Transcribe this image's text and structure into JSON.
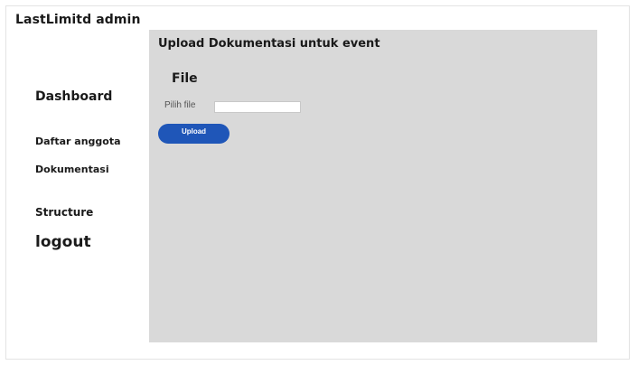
{
  "app": {
    "title": "LastLimitd admin"
  },
  "sidebar": {
    "items": [
      {
        "label": "Dashboard"
      },
      {
        "label": "Daftar anggota"
      },
      {
        "label": "Dokumentasi"
      },
      {
        "label": "Structure"
      },
      {
        "label": "logout"
      }
    ]
  },
  "main": {
    "title": "Upload Dokumentasi untuk event",
    "section_title": "File",
    "file_label": "Pilih file",
    "file_input": {
      "value": "",
      "placeholder": ""
    },
    "upload_label": "Upload"
  },
  "colors": {
    "panel_bg": "#d9d9d9",
    "button_bg": "#1f56b8",
    "button_text": "#ffffff"
  }
}
